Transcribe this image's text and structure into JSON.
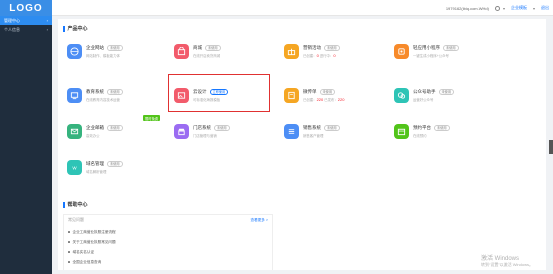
{
  "brand": {
    "logo": "LOGO"
  },
  "topbar": {
    "user_id": "1979162(ibiq.com.WHd)",
    "enterprise_label": "企业模板",
    "login_label": "退出"
  },
  "sidebar": {
    "items": [
      {
        "label": "管理中心",
        "arrow": "›",
        "active": true
      },
      {
        "label": "个人信息",
        "arrow": "›",
        "active": false
      }
    ]
  },
  "products": {
    "section_title": "产品中心",
    "cards": [
      {
        "title": "企业网站",
        "badge": "未使用",
        "desc": "网站制作、模板能力体",
        "icon": "globe-icon",
        "color": "#4d8ef5"
      },
      {
        "title": "商城",
        "badge": "未使用",
        "desc": "在线开店卖货商城",
        "icon": "shop-icon",
        "color": "#f25b6b"
      },
      {
        "title": "营销活动",
        "badge": "未使用",
        "desc": "已创建：",
        "num1": "0",
        "desc2": " 进行中：",
        "num2": "0",
        "icon": "gift-icon",
        "color": "#f5a623"
      },
      {
        "title": "轻应用小程序",
        "badge": "未使用",
        "desc": "一键生成小程序+公众号",
        "icon": "miniapp-icon",
        "color": "#f78a2a"
      },
      {
        "title": "教育系统",
        "badge": "未使用",
        "desc": "在线教育内容技术运营",
        "icon": "edu-icon",
        "color": "#4d8ef5"
      },
      {
        "title": "云设计",
        "badge": "立即使用",
        "desc": "可标准化海报模板",
        "icon": "design-icon",
        "color": "#f25b6b"
      },
      {
        "title": "微传单",
        "badge": "未使用",
        "desc": "已创建：",
        "num1": "220",
        "desc2": " 已发布：",
        "num2": "220",
        "icon": "flyer-icon",
        "color": "#f5a623"
      },
      {
        "title": "公众号助手",
        "badge": "未使用",
        "desc": "运营好公众号",
        "icon": "wechat-icon",
        "color": "#2ec4b6"
      },
      {
        "title": "企业邮箱",
        "badge": "未使用",
        "desc": "高效办公",
        "icon": "mail-icon",
        "color": "#36b37e"
      },
      {
        "title": "门店系统",
        "badge": "未使用",
        "desc": "门店管理与营销",
        "icon": "store-icon",
        "color": "#9b6cf2"
      },
      {
        "title": "销售系统",
        "badge": "未使用",
        "desc": "销售客户管理",
        "icon": "list-icon",
        "color": "#4d8ef5"
      },
      {
        "title": "预约平台",
        "badge": "未使用",
        "desc": "在线预约",
        "icon": "calendar-icon",
        "color": "#52c41a"
      },
      {
        "title": "域名管理",
        "badge": "未使用",
        "desc": "域名解析管理",
        "icon": "domain-icon",
        "color": "#2ec4b6"
      }
    ],
    "ribbon": "限时免费"
  },
  "help": {
    "section_title": "帮助中心",
    "box_title": "常见问题",
    "more": "查看更多 >",
    "items": [
      "企业工商营业执照注册流程",
      "关于工商营业执照常见问题",
      "域名实名认证",
      "全国企业信息查询"
    ]
  },
  "watermark": {
    "line1": "激活 Windows",
    "line2": "转到“设置”以激活 Windows。"
  }
}
